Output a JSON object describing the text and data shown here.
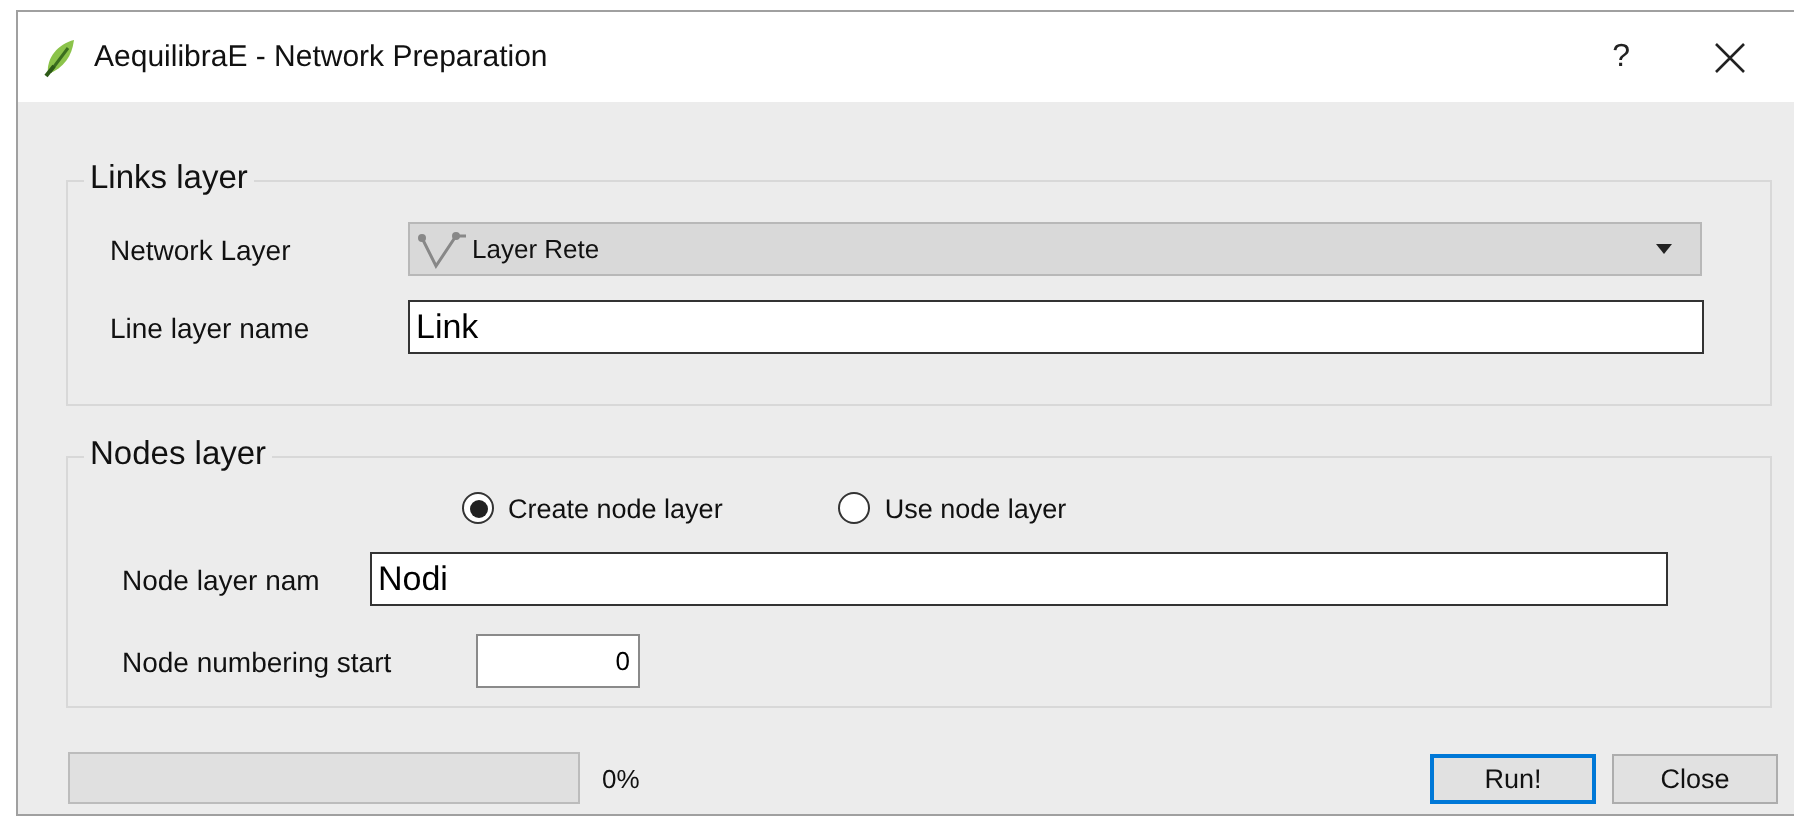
{
  "window": {
    "title": "AequilibraE - Network Preparation",
    "help": "?"
  },
  "links_layer": {
    "title": "Links layer",
    "network_layer": {
      "label": "Network Layer",
      "value": "Layer Rete"
    },
    "line_layer_name": {
      "label": "Line layer name",
      "value": "Link"
    }
  },
  "nodes_layer": {
    "title": "Nodes layer",
    "options": [
      {
        "label": "Create node layer",
        "selected": true
      },
      {
        "label": "Use node layer",
        "selected": false
      }
    ],
    "node_layer_name": {
      "label": "Node layer nam",
      "value": "Nodi"
    },
    "node_numbering_start": {
      "label": "Node numbering start",
      "value": "0"
    }
  },
  "progress": {
    "level": 0,
    "reading": "0%"
  },
  "buttons": [
    {
      "label": "Run!",
      "default": true
    },
    {
      "label": "Close",
      "default": false
    }
  ]
}
